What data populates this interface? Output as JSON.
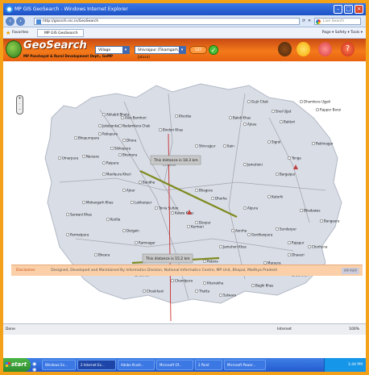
{
  "browser": {
    "title": "MP GIS GeoSearch - Windows Internet Explorer",
    "url": "http://gissrch.nic.in/GeoSearch",
    "search_placeholder": "Live Search",
    "favorites_label": "Favorites",
    "tab_label": "MP GIS GeoSearch",
    "tools_text": "Page ▾  Safety ▾  Tools ▾"
  },
  "site": {
    "brand": "GeoSearch",
    "dept": "MP Panchayat & Rural Development Dept., GoMP",
    "level_select": "Village",
    "place_select": "Shivrajpur (Tikamgarh, Jatara)",
    "go_label": "GO"
  },
  "map": {
    "labels": [
      "Dhamkera Ujgoli",
      "Gujri Chak",
      "Siral Ujjat",
      "Baktori",
      "Ajnau",
      "Bakdi Khas",
      "Rapper Barai",
      "Akhabit Bhata",
      "Aliie Bemhori",
      "Jakebanker",
      "Nadamkera Chak",
      "Patiapura",
      "Dhora",
      "Sikhopura",
      "Bhopurnpara",
      "Bindori Khas",
      "Kheribe",
      "Sigrol",
      "Rekhnagar",
      "Umarpura",
      "Narsara",
      "Raipura",
      "Bhamora",
      "Tonga",
      "Manfaura Kheri",
      "Bandha",
      "Ajnar",
      "Bargaipur",
      "Jamuhoni",
      "Shivrajpur",
      "Itain",
      "Tonia Sultan",
      "Bhagora",
      "Dharha",
      "Mohangarh Khas",
      "Sarwani Khas",
      "Kudila",
      "Dergain",
      "Lakhanpur",
      "Karwa Khas",
      "Devpur",
      "Alpura",
      "Katorhi",
      "Bhadawas",
      "Bangaura",
      "Parmatpura",
      "Aonrha",
      "Jamuhori Khas",
      "Gordhanpura",
      "Sundarpur",
      "Rajapur",
      "Chorhuna",
      "Patana",
      "Madalpur",
      "Maraura",
      "Rajpura",
      "Khairakha",
      "Chandpura",
      "Kuranti",
      "Gurwa",
      "Choukhani",
      "Nayagaon",
      "Bheera",
      "Gargrela",
      "Senwari",
      "Bhagwantpura",
      "Baghi Khas",
      "Raghunathpura",
      "Karmari",
      "Ramnagar",
      "Dhavari",
      "Sulwara",
      "Thatta",
      "Gorai"
    ],
    "distance_label_1": "This distance is 18.3 km",
    "distance_label_2": "This distance is 15.2 km"
  },
  "disclaimer": {
    "label": "Disclaimer",
    "text": "Designed, Developed and Maintained By Informatics Division, National Informatics Centre, MP Unit, Bhopal, Madhya Pradesh",
    "preview": "MP MAP"
  },
  "statusbar": {
    "left": "Done",
    "zone": "Internet",
    "zoom": "100%"
  },
  "taskbar": {
    "start_label": "start",
    "tasks": [
      "Windows Ex...",
      "2 Internet Ex...",
      "Adobe Illustr...",
      "Microsoft Of...",
      "2 Paint",
      "Microsoft Power..."
    ],
    "clock": "1:44 PM"
  },
  "colors": {
    "accent_orange": "#f4a11a",
    "measure_line": "#7f8a1e",
    "vertical_line": "#c81414"
  }
}
